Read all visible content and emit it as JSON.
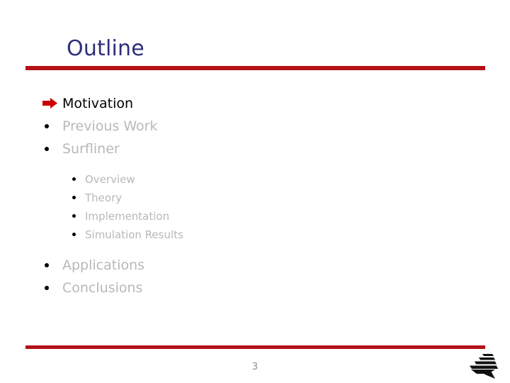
{
  "slide": {
    "title": "Outline",
    "page_number": "3",
    "colors": {
      "title": "#2e2e7d",
      "rule": "#b51117",
      "current_text": "#000000",
      "inactive_text": "#b8b8b8",
      "arrow_marker": "#cc0000",
      "page_number": "#8f8f8f"
    },
    "logo_name": "institution-logo"
  },
  "outline": {
    "items": [
      {
        "label": "Motivation",
        "level": 1,
        "marker": "red-arrow",
        "state": "current"
      },
      {
        "label": "Previous Work",
        "level": 1,
        "marker": "dot",
        "state": "inactive"
      },
      {
        "label": "Surfliner",
        "level": 1,
        "marker": "dot",
        "state": "inactive"
      },
      {
        "label": "Overview",
        "level": 2,
        "marker": "dot",
        "state": "inactive"
      },
      {
        "label": "Theory",
        "level": 2,
        "marker": "dot",
        "state": "inactive"
      },
      {
        "label": "Implementation",
        "level": 2,
        "marker": "dot",
        "state": "inactive"
      },
      {
        "label": "Simulation Results",
        "level": 2,
        "marker": "dot",
        "state": "inactive"
      },
      {
        "label": "Applications",
        "level": 1,
        "marker": "dot",
        "state": "inactive"
      },
      {
        "label": "Conclusions",
        "level": 1,
        "marker": "dot",
        "state": "inactive"
      }
    ]
  }
}
